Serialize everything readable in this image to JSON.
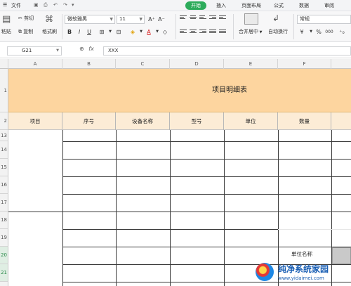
{
  "menubar": {
    "file": "文件",
    "tabs": [
      "开始",
      "插入",
      "页面布局",
      "公式",
      "数据",
      "审阅"
    ]
  },
  "ribbon": {
    "cut": "剪切",
    "paste": "粘贴",
    "copy": "复制",
    "format_painter": "格式刷",
    "font_name": "微软雅黑",
    "font_size": "11",
    "bold": "B",
    "italic": "I",
    "underline": "U",
    "grow_font": "A⁺",
    "shrink_font": "A⁻",
    "merge_center": "合并居中",
    "wrap_text": "自动换行",
    "number_format": "常规",
    "currency": "¥",
    "percent": "%",
    "thousands": "000"
  },
  "formula_bar": {
    "cell_ref": "G21",
    "fx": "fx",
    "content": "XXX"
  },
  "columns": [
    "A",
    "B",
    "C",
    "D",
    "E",
    "F"
  ],
  "rows": [
    "1",
    "2",
    "13",
    "14",
    "15",
    "16",
    "17",
    "18",
    "19",
    "20",
    "21",
    "22"
  ],
  "sheet": {
    "title": "项目明细表",
    "headers": [
      "项目",
      "序号",
      "设备名称",
      "型号",
      "单位",
      "数量"
    ],
    "partial_label": "单位名称"
  },
  "watermark": {
    "title": "纯净系统家园",
    "url": "www.yidaimei.com"
  },
  "colors": {
    "accent": "#2cab5b",
    "title_fill": "#fdd59f",
    "header_fill": "#fcecd6"
  }
}
